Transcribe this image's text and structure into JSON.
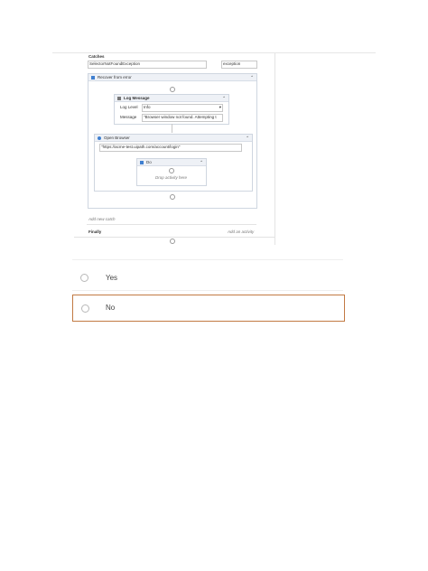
{
  "screenshot": {
    "catches_label": "Catches",
    "exception_type": "SelectorNotFoundException",
    "exception_var": "exception",
    "recover_label": "Recover from error",
    "log_title": "Log Message",
    "log_level_label": "Log Level",
    "log_level_value": "Info",
    "message_label": "Message",
    "message_value": "\"Browser window not found. Attempting t",
    "open_browser_title": "Open Browser",
    "url_value": "\"https://acme-test.uipath.com/account/login\"",
    "do_label": "Do",
    "drop_hint": "Drop activity here",
    "add_catch": "Add new catch",
    "finally_label": "Finally",
    "add_activity": "Add an activity"
  },
  "options": [
    {
      "label": "Yes",
      "selected": false
    },
    {
      "label": "No",
      "selected": true
    }
  ],
  "colors": {
    "selected_border": "#c27a43",
    "activity_icon": "#3f7fd0"
  }
}
